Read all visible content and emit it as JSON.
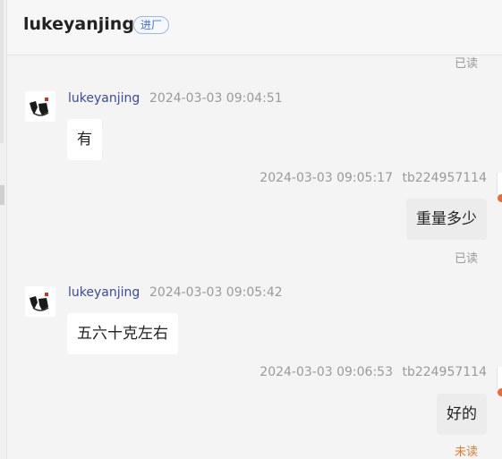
{
  "header": {
    "title": "lukeyanjing",
    "badge": "进厂"
  },
  "messages": [
    {
      "status": "已读"
    },
    {
      "sender": "lukeyanjing",
      "time": "2024-03-03 09:04:51",
      "text": "有"
    },
    {
      "time": "2024-03-03 09:05:17",
      "sender": "tb224957114",
      "text": "重量多少",
      "status": "已读"
    },
    {
      "sender": "lukeyanjing",
      "time": "2024-03-03 09:05:42",
      "text": "五六十克左右"
    },
    {
      "time": "2024-03-03 09:06:53",
      "sender": "tb224957114",
      "text": "好的",
      "status": "未读"
    }
  ],
  "colors": {
    "unread": "#e07b2c",
    "badge": "#3f6fd8",
    "sender": "#3a4aa0"
  }
}
